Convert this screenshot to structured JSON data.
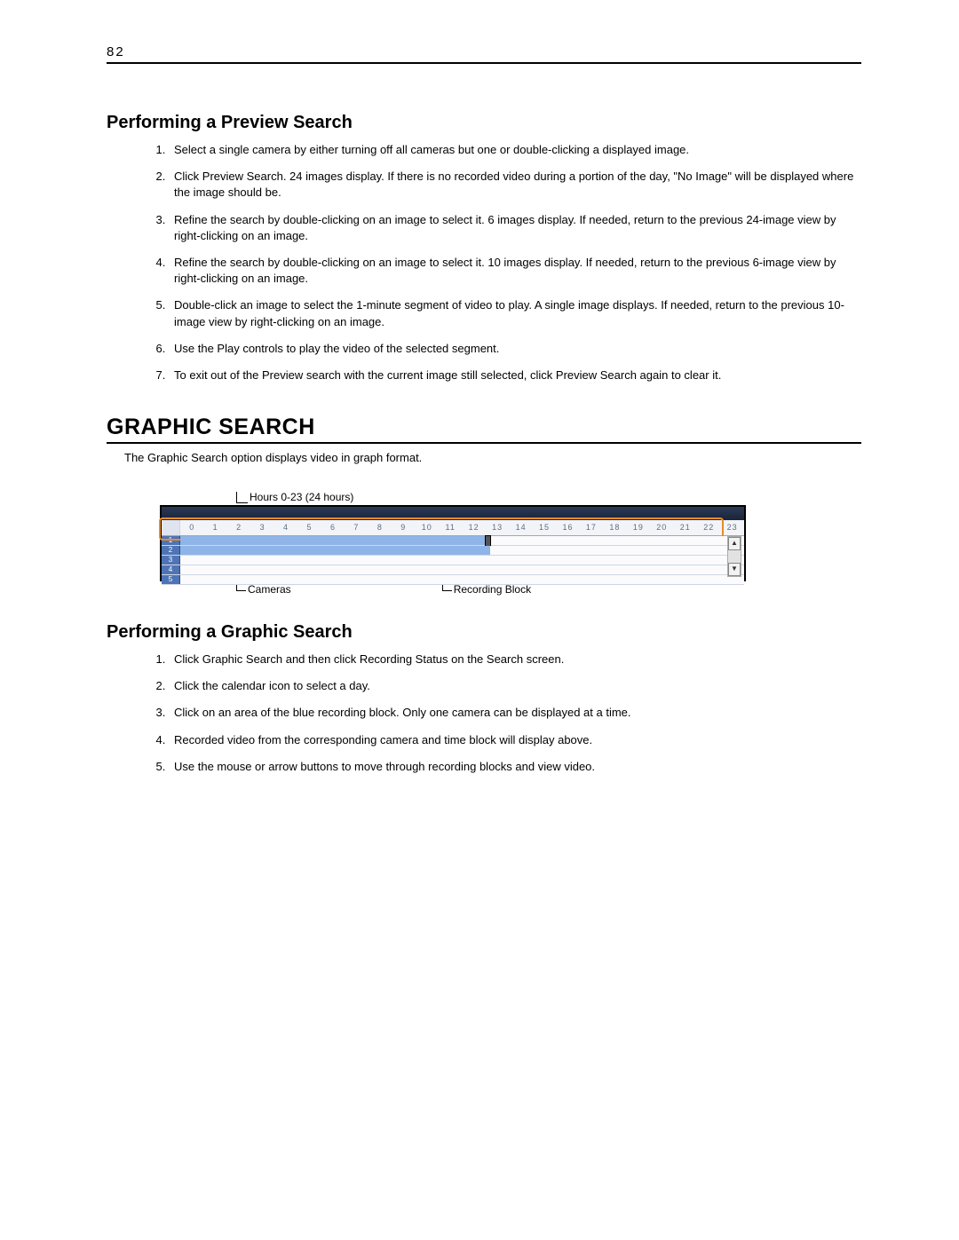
{
  "page_number": "82",
  "section1": {
    "heading": "Performing a Preview Search",
    "steps": [
      "Select a single camera by either turning off all cameras but one or double-clicking a displayed image.",
      "Click Preview Search.  24 images display.  If there is no recorded video during a portion of the day, \"No Image\" will be displayed where the image should be.",
      "Refine the search by double-clicking on an image to select it.  6 images display. If needed, return to the previous 24-image view by right-clicking on an image.",
      "Refine the search by double-clicking on an image to select it.  10 images display. If needed, return to the previous 6-image view by right-clicking on an image.",
      "Double-click an image to select the 1-minute segment of video to play.  A single image displays.  If needed, return to the previous 10-image view by right-clicking on an image.",
      "Use the Play controls to play the video of the selected segment.",
      "To exit out of the Preview search with the current image still selected, click Preview Search again to clear it."
    ]
  },
  "section2": {
    "heading": "GRAPHIC SEARCH",
    "intro": "The Graphic Search option displays video in graph format."
  },
  "figure": {
    "label_hours": "Hours 0-23 (24 hours)",
    "label_cameras": "Cameras",
    "label_recording": "Recording Block",
    "hours": [
      "0",
      "1",
      "2",
      "3",
      "4",
      "5",
      "6",
      "7",
      "8",
      "9",
      "10",
      "11",
      "12",
      "13",
      "14",
      "15",
      "16",
      "17",
      "18",
      "19",
      "20",
      "21",
      "22",
      "23"
    ],
    "cameras": [
      "1",
      "2",
      "3",
      "4",
      "5"
    ]
  },
  "section3": {
    "heading": "Performing a Graphic Search",
    "steps": [
      "Click Graphic Search and then click Recording Status on the Search screen.",
      "Click the calendar icon to select a day.",
      "Click on an area of the blue recording block. Only one camera can be displayed at a time.",
      "Recorded video from the corresponding camera and time block will display above.",
      "Use the mouse or arrow buttons to move through recording blocks and view video."
    ]
  }
}
